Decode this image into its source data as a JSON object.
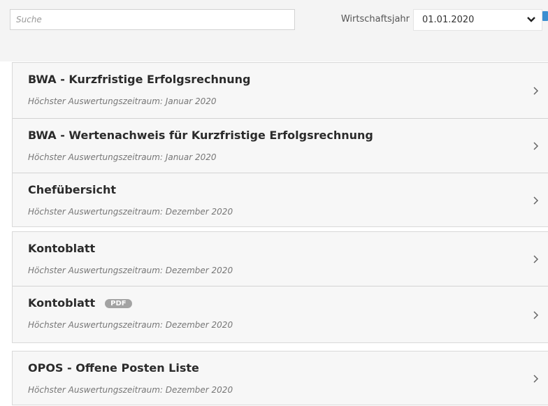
{
  "search": {
    "placeholder": "Suche",
    "value": ""
  },
  "fiscal_year": {
    "label": "Wirtschaftsjahr",
    "value": "01.01.2020"
  },
  "icons": {
    "dropdown": "chevron-down-icon",
    "row": "chevron-right-icon",
    "edge": "calendar-icon"
  },
  "colors": {
    "card_background": "#f7f7f7",
    "badge": "#a3a3a3",
    "edge_icon": "#3b8fd1"
  },
  "groups": [
    {
      "items": [
        {
          "title": "BWA - Kurzfristige Erfolgsrechnung",
          "subtitle": "Höchster Auswertungszeitraum: Januar 2020"
        },
        {
          "title": "BWA - Wertenachweis für Kurzfristige Erfolgsrechnung",
          "subtitle": "Höchster Auswertungszeitraum: Januar 2020"
        },
        {
          "title": "Chefübersicht",
          "subtitle": "Höchster Auswertungszeitraum: Dezember 2020"
        }
      ]
    },
    {
      "items": [
        {
          "title": "Kontoblatt",
          "subtitle": "Höchster Auswertungszeitraum: Dezember 2020"
        },
        {
          "title": "Kontoblatt",
          "badge": "PDF",
          "subtitle": "Höchster Auswertungszeitraum: Dezember 2020"
        }
      ]
    },
    {
      "items": [
        {
          "title": "OPOS - Offene Posten Liste",
          "subtitle": "Höchster Auswertungszeitraum: Dezember 2020"
        }
      ]
    }
  ]
}
